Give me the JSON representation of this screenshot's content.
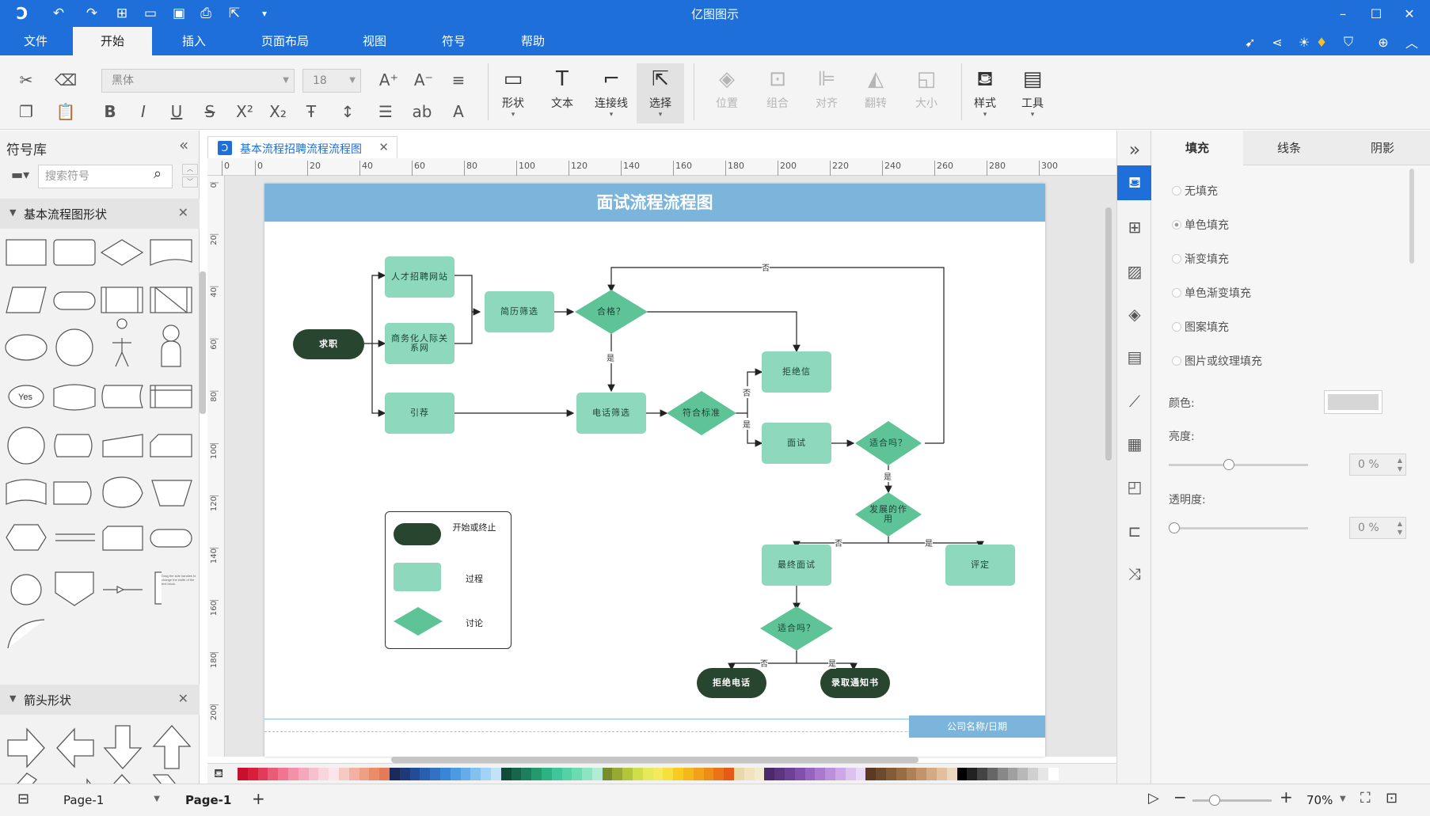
{
  "app": {
    "title": "亿图图示",
    "tabs": [
      "文件",
      "开始",
      "插入",
      "页面布局",
      "视图",
      "符号",
      "帮助"
    ],
    "active_tab": "开始"
  },
  "ribbon": {
    "font_name": "黑体",
    "font_size": "18",
    "groups": [
      {
        "label": "形状",
        "icon": "rectangle-icon"
      },
      {
        "label": "文本",
        "icon": "text-icon"
      },
      {
        "label": "连接线",
        "icon": "connector-icon"
      },
      {
        "label": "选择",
        "icon": "cursor-icon"
      },
      {
        "label": "位置",
        "icon": "layers-icon"
      },
      {
        "label": "组合",
        "icon": "group-icon"
      },
      {
        "label": "对齐",
        "icon": "align-icon"
      },
      {
        "label": "翻转",
        "icon": "flip-icon"
      },
      {
        "label": "大小",
        "icon": "resize-icon"
      },
      {
        "label": "样式",
        "icon": "paint-bucket-icon"
      },
      {
        "label": "工具",
        "icon": "tools-icon"
      }
    ]
  },
  "library": {
    "title": "符号库",
    "search_placeholder": "搜索符号",
    "section1": "基本流程图形状",
    "section2": "箭头形状",
    "yes_label": "Yes",
    "note_text": "Drag the side handles to change the width of the text block."
  },
  "document": {
    "tab_title": "基本流程招聘流程流程图",
    "page_title": "面试流程流程图",
    "footer": "公司名称/日期"
  },
  "ruler": {
    "h_ticks": [
      "0",
      "0",
      "20",
      "40",
      "60",
      "80",
      "100",
      "120",
      "140",
      "160",
      "180",
      "200",
      "220",
      "240",
      "260",
      "280",
      "300"
    ],
    "v_ticks": [
      "0",
      "20",
      "40",
      "60",
      "80",
      "100",
      "120",
      "140",
      "160",
      "180",
      "200"
    ]
  },
  "diagram": {
    "nodes": {
      "start": "求职",
      "site": "人才招聘网站",
      "social": "商务化人际关系网",
      "referral": "引荐",
      "screen": "简历筛选",
      "qualified": "合格？",
      "phone": "电话筛选",
      "meets": "符合标准",
      "reject_letter": "拒绝信",
      "interview": "面试",
      "suitable": "适合吗？",
      "growth": "发展的作用",
      "final": "最终面试",
      "evaluate": "评定",
      "suitable2": "适合吗？",
      "reject_call": "拒绝电话",
      "offer": "录取通知书"
    },
    "edge_labels": {
      "no1": "否",
      "yes1": "是",
      "no2": "否",
      "yes2": "是",
      "yes3": "是",
      "no3": "否",
      "yes4": "是",
      "no4": "否",
      "yes5": "是"
    },
    "legend": {
      "terminator": "开始或终止",
      "process": "过程",
      "decision": "讨论"
    }
  },
  "palette": [
    "#c8102e",
    "#d81e3a",
    "#e23b5a",
    "#ea5b78",
    "#ef7590",
    "#f291a8",
    "#f5a8bb",
    "#f8bfce",
    "#fad4de",
    "#fce4ea",
    "#f6c9c3",
    "#f3b0a3",
    "#efa084",
    "#ea8c6a",
    "#e57a56",
    "#1c2a5a",
    "#1f3a78",
    "#234c96",
    "#2a5fae",
    "#3172c4",
    "#3a86d6",
    "#4c9ae2",
    "#64adea",
    "#82c0ef",
    "#a3d3f4",
    "#c1e2f7",
    "#0f4c3a",
    "#16664c",
    "#1d7f5d",
    "#24996f",
    "#2db383",
    "#3ec69a",
    "#55d1a6",
    "#6cdab2",
    "#8de3c3",
    "#b3ecd6",
    "#7a8b2a",
    "#97a833",
    "#b4c53c",
    "#d0df49",
    "#e4ea5a",
    "#f5ea5c",
    "#f7df3e",
    "#f7cc21",
    "#f5b81c",
    "#f2a21a",
    "#ee8c18",
    "#ea7316",
    "#e55a14",
    "#ead9a8",
    "#f0e3bd",
    "#f4ead0",
    "#4a2a6a",
    "#5c3580",
    "#6e4196",
    "#8250ab",
    "#9663bf",
    "#a978cf",
    "#bb8fdc",
    "#cca8e6",
    "#dcc2ef",
    "#ead9f6",
    "#5a3a22",
    "#6e4a2c",
    "#835b37",
    "#986d44",
    "#ad8055",
    "#c1946a",
    "#d3aa83",
    "#e2c09f",
    "#eed6bd",
    "#000000",
    "#222222",
    "#444444",
    "#666666",
    "#888888",
    "#a0a0a0",
    "#b8b8b8",
    "#d0d0d0",
    "#e6e6e6",
    "#ffffff"
  ],
  "right_panel": {
    "tabs": [
      "填充",
      "线条",
      "阴影"
    ],
    "active_tab": "填充",
    "fill_options": [
      "无填充",
      "单色填充",
      "渐变填充",
      "单色渐变填充",
      "图案填充",
      "图片或纹理填充"
    ],
    "selected_fill": "单色填充",
    "color_label": "颜色:",
    "brightness_label": "亮度:",
    "brightness_value": "0 %",
    "brightness_fraction": 0.43,
    "opacity_label": "透明度:",
    "opacity_value": "0 %",
    "opacity_fraction": 0.0,
    "swatch_color": "#d6d6d6"
  },
  "status": {
    "page_select": "Page-1",
    "page_tab": "Page-1",
    "zoom": "70%",
    "zoom_fraction": 0.28
  }
}
